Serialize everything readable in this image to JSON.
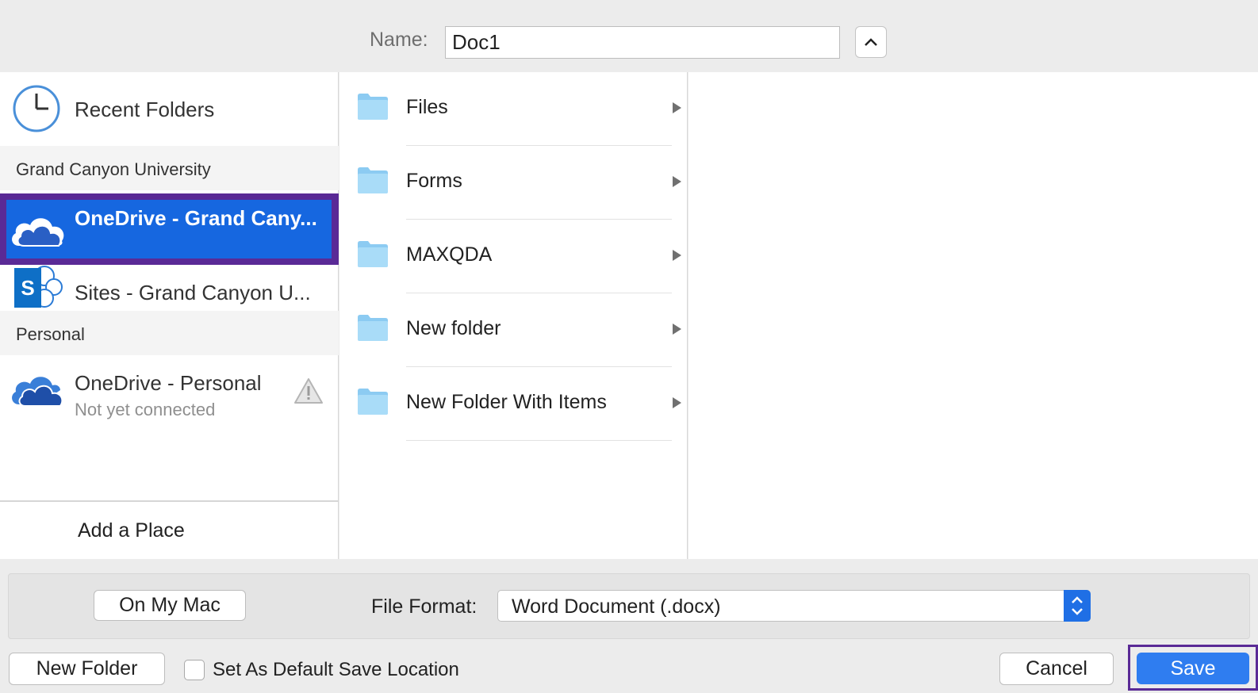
{
  "name_bar": {
    "label": "Name:",
    "value": "Doc1"
  },
  "sidebar": {
    "recent": {
      "label": "Recent Folders",
      "icon": "clock-icon"
    },
    "sections": [
      {
        "header": "Grand Canyon University"
      },
      {
        "header": "Personal"
      }
    ],
    "items": [
      {
        "label": "OneDrive - Grand Cany...",
        "icon": "onedrive-cloud-icon",
        "selected": true
      },
      {
        "label": "Sites - Grand Canyon U...",
        "icon": "sharepoint-icon"
      },
      {
        "label": "OneDrive - Personal",
        "sublabel": "Not yet connected",
        "icon": "onedrive-cloud-icon",
        "status_icon": "warning-icon"
      }
    ],
    "add_place": "Add a Place"
  },
  "folders": [
    {
      "name": "Files"
    },
    {
      "name": "Forms"
    },
    {
      "name": "MAXQDA"
    },
    {
      "name": "New folder"
    },
    {
      "name": "New Folder With Items"
    }
  ],
  "bottom": {
    "on_my_mac": "On My Mac",
    "file_format_label": "File Format:",
    "file_format_value": "Word Document (.docx)",
    "new_folder": "New Folder",
    "default_location_label": "Set As Default Save Location",
    "default_location_checked": false,
    "cancel": "Cancel",
    "save": "Save"
  },
  "colors": {
    "selection": "#1667e0",
    "highlight_border": "#5a2a96",
    "save_button": "#2f7df0"
  }
}
